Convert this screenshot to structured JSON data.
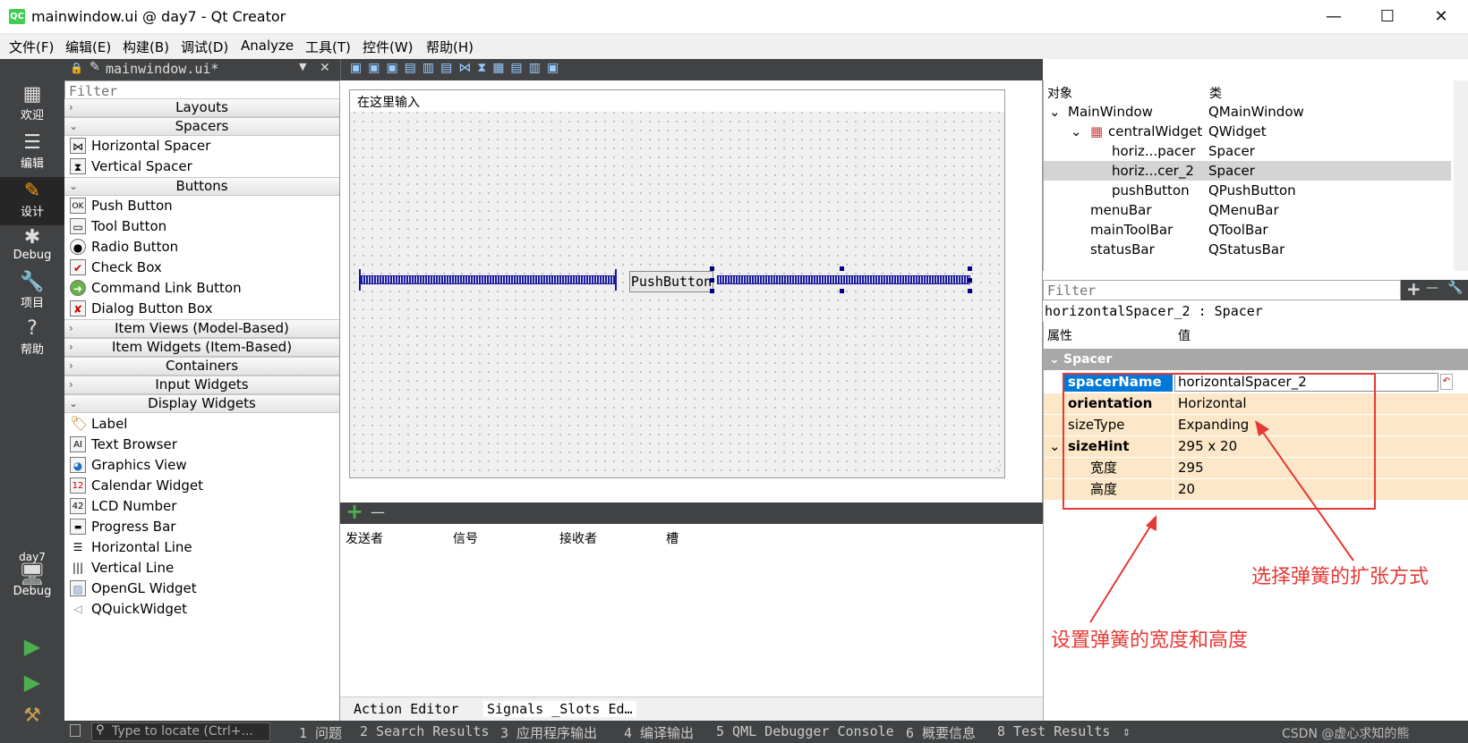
{
  "window": {
    "title": "mainwindow.ui @ day7 - Qt Creator",
    "logo": "QC",
    "minimize_glyph": "—",
    "maximize_glyph": "☐",
    "close_glyph": "✕"
  },
  "menu": [
    "文件(F)",
    "编辑(E)",
    "构建(B)",
    "调试(D)",
    "Analyze",
    "工具(T)",
    "控件(W)",
    "帮助(H)"
  ],
  "modes": [
    {
      "label": "欢迎",
      "icon": "grid-icon",
      "glyph": "▦"
    },
    {
      "label": "编辑",
      "icon": "edit-doc-icon",
      "glyph": "☰"
    },
    {
      "label": "设计",
      "icon": "pencil-icon",
      "glyph": "✎"
    },
    {
      "label": "Debug",
      "icon": "bug-icon",
      "glyph": "✱"
    },
    {
      "label": "项目",
      "icon": "wrench-icon",
      "glyph": "🔧"
    },
    {
      "label": "帮助",
      "icon": "help-icon",
      "glyph": "?"
    }
  ],
  "kit": {
    "project": "day7",
    "config": "Debug"
  },
  "editor_tab": {
    "filename": "mainwindow.ui*",
    "close": "✕"
  },
  "widgetbox": {
    "filter_placeholder": "Filter",
    "categories": {
      "layouts": "Layouts",
      "spacers": "Spacers",
      "buttons": "Buttons",
      "item_views": "Item Views (Model-Based)",
      "item_widgets": "Item Widgets (Item-Based)",
      "containers": "Containers",
      "input_widgets": "Input Widgets",
      "display_widgets": "Display Widgets"
    },
    "spacers": [
      "Horizontal Spacer",
      "Vertical Spacer"
    ],
    "buttons": [
      "Push Button",
      "Tool Button",
      "Radio Button",
      "Check Box",
      "Command Link Button",
      "Dialog Button Box"
    ],
    "display": [
      "Label",
      "Text Browser",
      "Graphics View",
      "Calendar Widget",
      "LCD Number",
      "Progress Bar",
      "Horizontal Line",
      "Vertical Line",
      "OpenGL Widget",
      "QQuickWidget"
    ]
  },
  "form": {
    "menu_placeholder": "在这里输入",
    "pushbutton_text": "PushButton"
  },
  "signals": {
    "add": "+",
    "remove": "—",
    "columns": [
      "发送者",
      "信号",
      "接收者",
      "槽"
    ],
    "tabs": [
      "Action Editor",
      "Signals _Slots Ed…"
    ]
  },
  "object_inspector": {
    "headers": [
      "对象",
      "类"
    ],
    "rows": [
      {
        "name": "MainWindow",
        "class": "QMainWindow",
        "indent": 0,
        "expander": "⌄"
      },
      {
        "name": "centralWidget",
        "class": "QWidget",
        "indent": 1,
        "expander": "⌄"
      },
      {
        "name": "horiz...pacer",
        "class": "Spacer",
        "indent": 2,
        "expander": ""
      },
      {
        "name": "horiz...cer_2",
        "class": "Spacer",
        "indent": 2,
        "expander": ""
      },
      {
        "name": "pushButton",
        "class": "QPushButton",
        "indent": 2,
        "expander": ""
      },
      {
        "name": "menuBar",
        "class": "QMenuBar",
        "indent": 1,
        "expander": ""
      },
      {
        "name": "mainToolBar",
        "class": "QToolBar",
        "indent": 1,
        "expander": ""
      },
      {
        "name": "statusBar",
        "class": "QStatusBar",
        "indent": 1,
        "expander": ""
      }
    ]
  },
  "property_editor": {
    "filter_placeholder": "Filter",
    "add": "+",
    "remove": "—",
    "object_label": "horizontalSpacer_2 : Spacer",
    "headers": [
      "属性",
      "值"
    ],
    "group": "Spacer",
    "rows": [
      {
        "name": "spacerName",
        "value": "horizontalSpacer_2"
      },
      {
        "name": "orientation",
        "value": "Horizontal"
      },
      {
        "name": "sizeType",
        "value": "Expanding"
      },
      {
        "name": "sizeHint",
        "value": "295 x 20"
      },
      {
        "name": "宽度",
        "value": "295"
      },
      {
        "name": "高度",
        "value": "20"
      }
    ]
  },
  "annotations": {
    "expand_mode": "选择弹簧的扩张方式",
    "width_height": "设置弹簧的宽度和高度",
    "color": "#e53935"
  },
  "statusbar": {
    "locate_placeholder": "Type to locate (Ctrl+...",
    "items": [
      "1 问题",
      "2 Search Results",
      "3 应用程序输出",
      "4 编译输出",
      "5 QML Debugger Console",
      "6 概要信息",
      "8 Test Results"
    ],
    "more": "⇕",
    "watermark": "CSDN @虚心求知的熊"
  }
}
